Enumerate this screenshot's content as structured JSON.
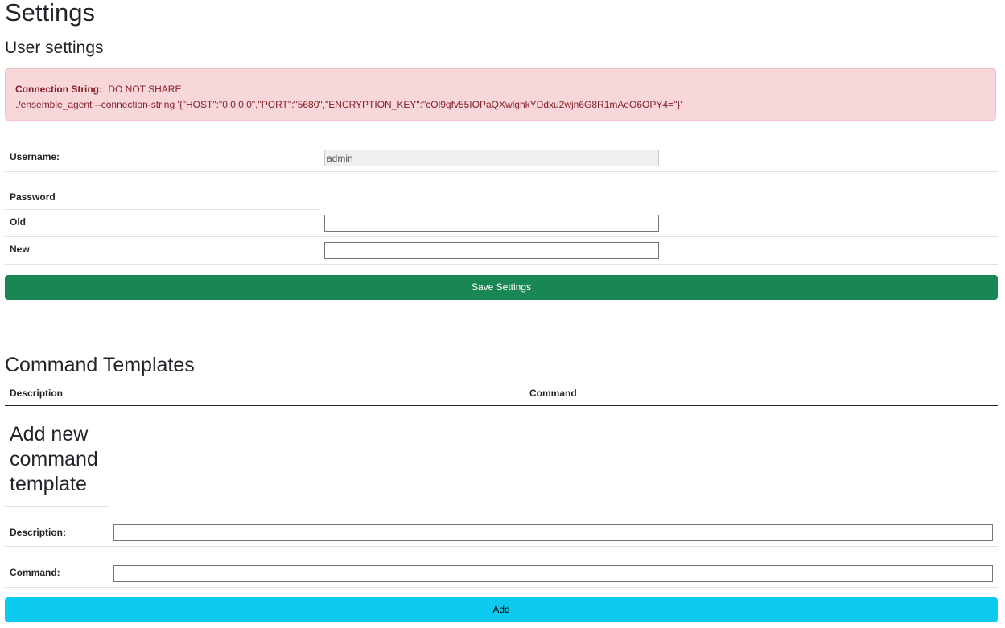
{
  "page": {
    "title": "Settings"
  },
  "user_settings": {
    "title": "User settings",
    "alert": {
      "label": "Connection String:",
      "warning": "DO NOT SHARE",
      "command": "./ensemble_agent --connection-string '{\"HOST\":\"0.0.0.0\",\"PORT\":\"5680\",\"ENCRYPTION_KEY\":\"cOl9qfv55IOPaQXwlghkYDdxu2wjn6G8R1mAeO6OPY4=\"}'"
    },
    "username_label": "Username:",
    "username_value": "admin",
    "password_label": "Password",
    "old_label": "Old",
    "old_value": "",
    "new_label": "New",
    "new_value": "",
    "save_button": "Save Settings"
  },
  "command_templates": {
    "title": "Command Templates",
    "columns": [
      "Description",
      "Command"
    ],
    "rows": [],
    "add_title": "Add new command template",
    "description_label": "Description:",
    "description_value": "",
    "command_label": "Command:",
    "command_value": "",
    "add_button": "Add"
  },
  "colors": {
    "alert_bg": "#f8d7da",
    "alert_text": "#842029",
    "save_button": "#198754",
    "add_button": "#0dcaf0"
  }
}
